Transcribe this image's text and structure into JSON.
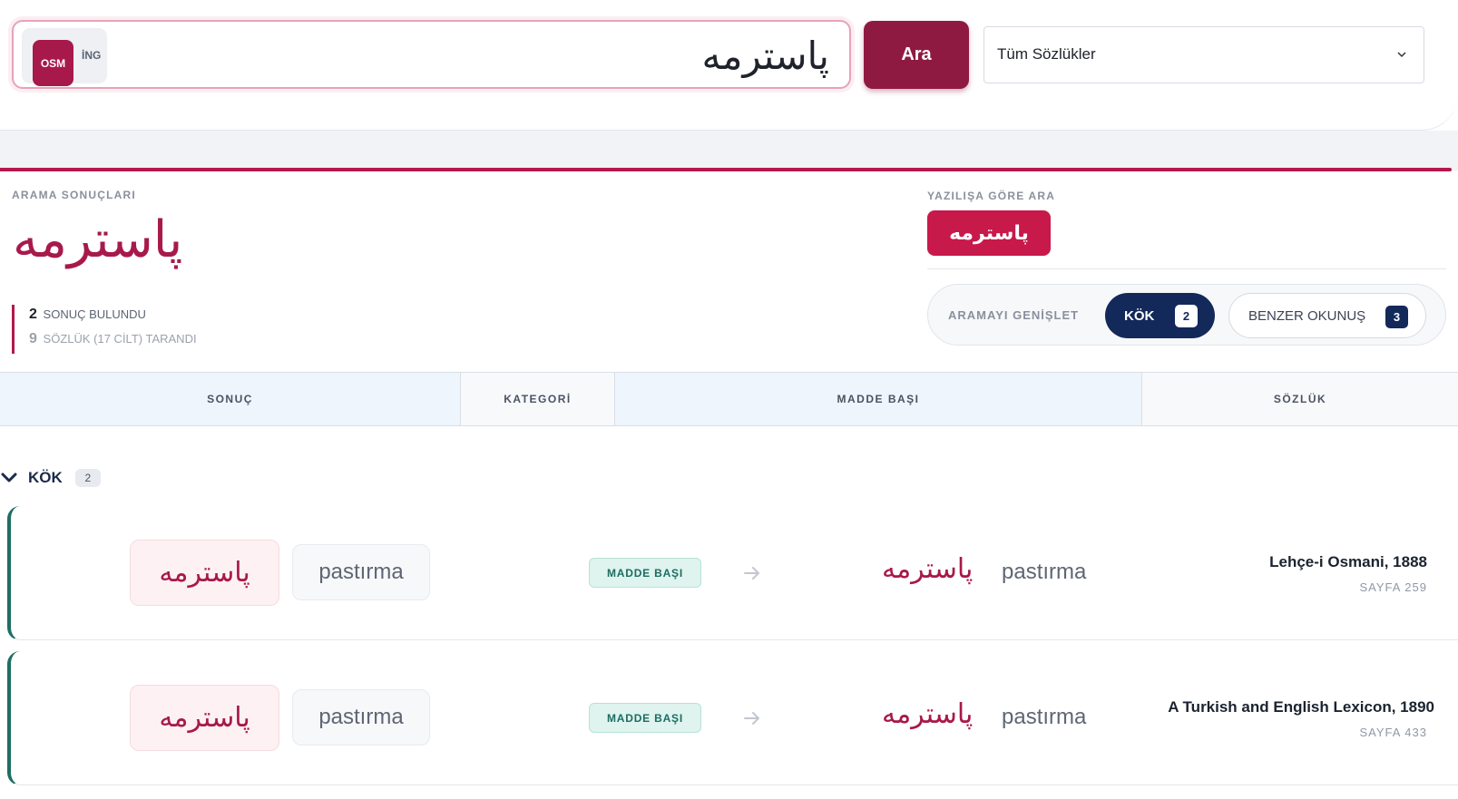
{
  "search": {
    "lang_osm": "OSM",
    "lang_ing": "İNG",
    "query": "پاسترمه",
    "button_label": "Ara",
    "dictionary_selected": "Tüm Sözlükler"
  },
  "results": {
    "section_label": "ARAMA SONUÇLARI",
    "term": "پاسترمه",
    "result_count": "2",
    "result_count_label": "SONUÇ BULUNDU",
    "dict_count": "9",
    "dict_count_label": "SÖZLÜK (17 CİLT) TARANDI"
  },
  "spelling": {
    "label": "YAZILIŞA GÖRE ARA",
    "term": "پاسترمه"
  },
  "expand": {
    "label": "ARAMAYI GENİŞLET",
    "chips": [
      {
        "label": "KÖK",
        "count": "2"
      },
      {
        "label": "BENZER OKUNUŞ",
        "count": "3"
      }
    ]
  },
  "table": {
    "headers": [
      "SONUÇ",
      "KATEGORİ",
      "MADDE BAŞI",
      "SÖZLÜK"
    ]
  },
  "group": {
    "label": "KÖK",
    "count": "2"
  },
  "rows": [
    {
      "term_osm": "پاسترمه",
      "term_lat": "pastırma",
      "category": "MADDE BAŞI",
      "head_osm": "پاسترمه",
      "head_lat": "pastırma",
      "dictionary": "Lehçe-i Osmani, 1888",
      "page": "SAYFA 259"
    },
    {
      "term_osm": "پاسترمه",
      "term_lat": "pastırma",
      "category": "MADDE BAŞI",
      "head_osm": "پاسترمه",
      "head_lat": "pastırma",
      "dictionary": "A Turkish and English Lexicon, 1890",
      "page": "SAYFA 433"
    }
  ],
  "colors": {
    "brand": "#a8194b",
    "navy": "#13295a",
    "teal": "#1e6e63"
  }
}
